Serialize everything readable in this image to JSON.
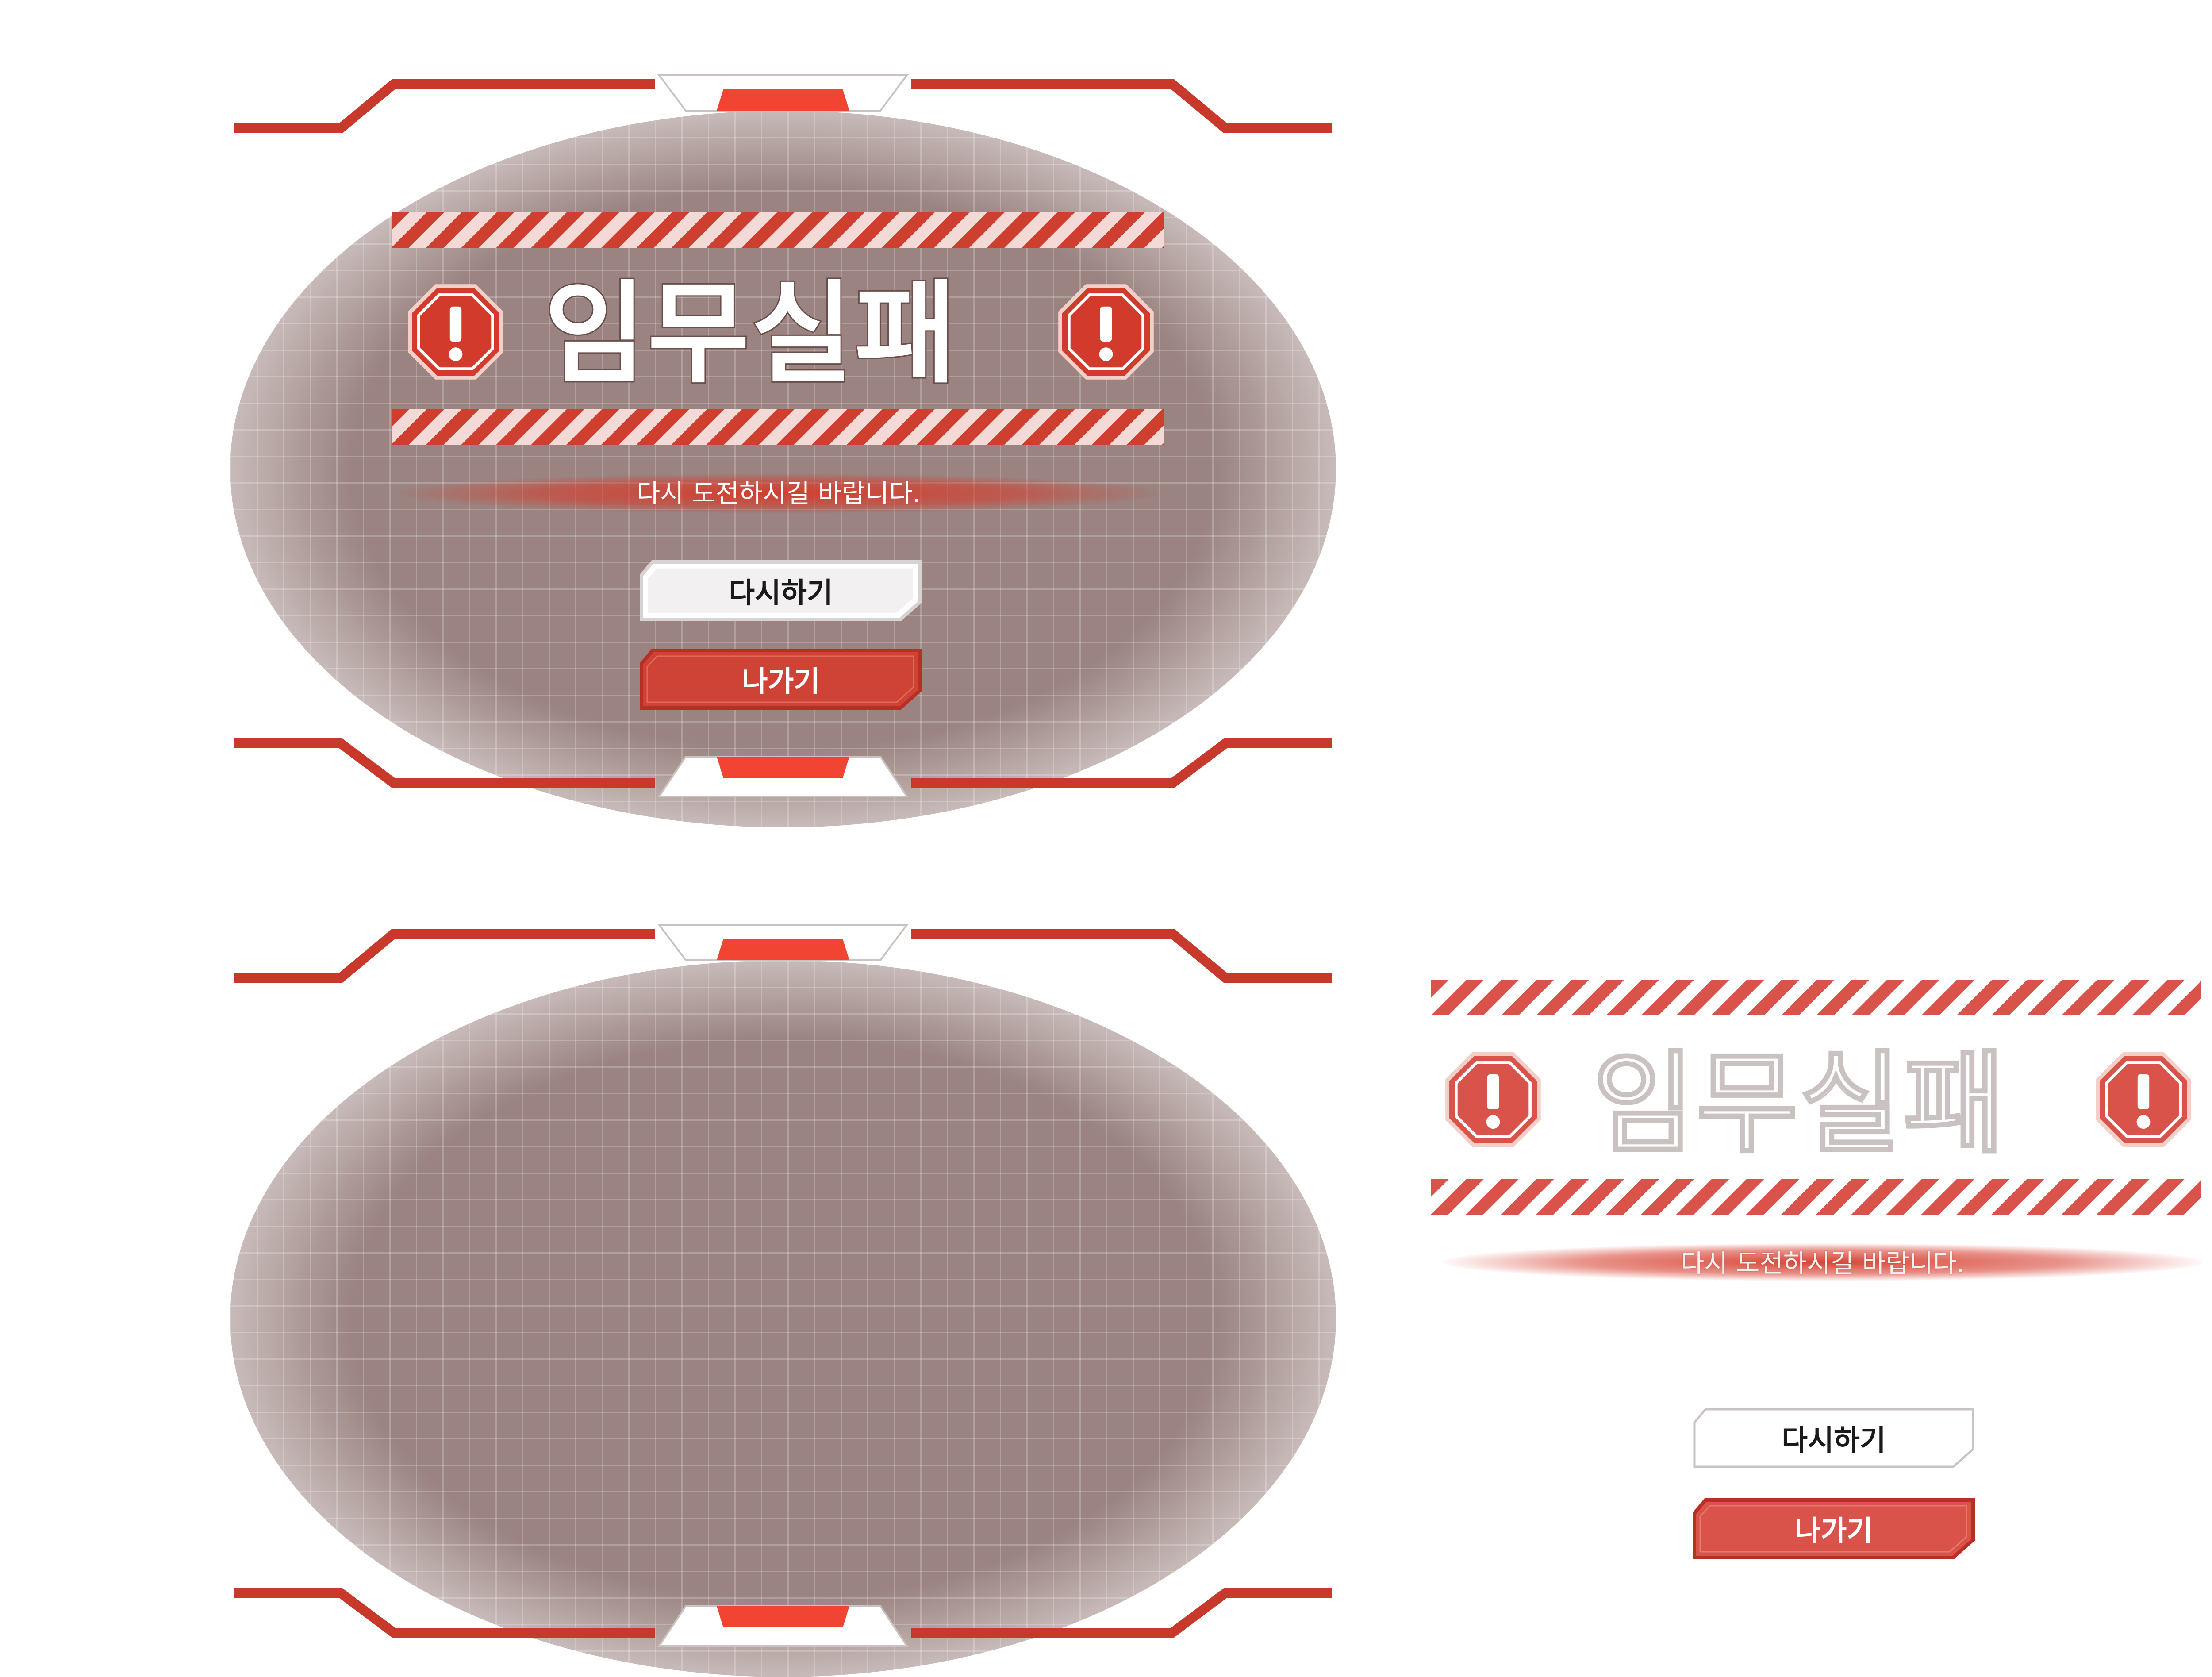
{
  "screen_main": {
    "title": "임무실패",
    "subtitle": "다시 도전하시길 바랍니다.",
    "retry_label": "다시하기",
    "exit_label": "나가기"
  },
  "screen_empty": {},
  "asset_sheet": {
    "title": "임무실패",
    "subtitle": "다시 도전하시길 바랍니다.",
    "retry_label": "다시하기",
    "exit_label": "나가기"
  },
  "icons": {
    "warning": "warning-octagon-icon"
  },
  "colors": {
    "frame_red": "#c8392b",
    "accent_red": "#f24432",
    "button_red": "#cf4337",
    "panel": "#9a8380",
    "stripe_light": "#f3dad6"
  }
}
